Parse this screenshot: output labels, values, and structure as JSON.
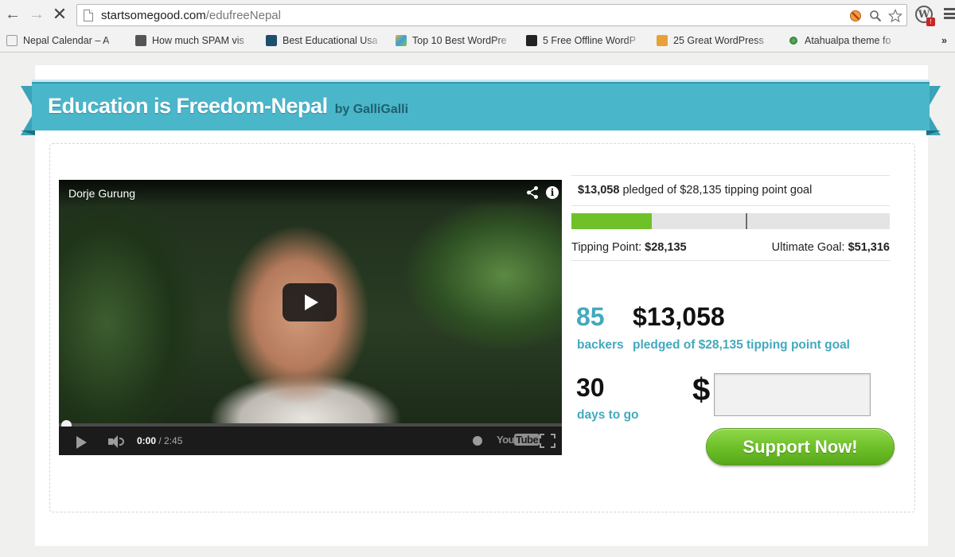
{
  "browser": {
    "url_host": "startsomegood.com",
    "url_path": "/edufreeNepal",
    "bookmarks": [
      {
        "label": "Nepal Calendar – A",
        "favicon_color": "#ffffff"
      },
      {
        "label": "How much SPAM vis",
        "favicon_color": "#555555"
      },
      {
        "label": "Best Educational Usa",
        "favicon_color": "#1d4e6e"
      },
      {
        "label": "Top 10 Best WordPre",
        "favicon_color": "#e0b53a"
      },
      {
        "label": "5 Free Offline WordP",
        "favicon_color": "#222222"
      },
      {
        "label": "25 Great WordPress",
        "favicon_color": "#e8a13a"
      },
      {
        "label": "Atahualpa theme fo",
        "favicon_color": "#4caf50"
      }
    ]
  },
  "campaign": {
    "title": "Education is Freedom-Nepal",
    "byline": "by GalliGalli"
  },
  "video": {
    "title": "Dorje Gurung",
    "current_time": "0:00",
    "separator": " / ",
    "duration": "2:45",
    "youtube_you": "You",
    "youtube_tube": "Tube"
  },
  "stats": {
    "pledged_amount": "$13,058",
    "pledged_suffix": " pledged of $28,135 tipping point goal",
    "progress_fraction": 0.253,
    "tipping_marker_fraction": 0.547,
    "tipping_point_label": "Tipping Point:",
    "tipping_point_value": "$28,135",
    "ultimate_goal_label": "Ultimate Goal:",
    "ultimate_goal_value": "$51,316",
    "backers_count": "85",
    "backers_label": "backers",
    "pledged_big": "$13,058",
    "pledged_big_label": "pledged of $28,135 tipping point goal",
    "days_count": "30",
    "days_label": "days to go"
  },
  "pledge_form": {
    "currency_symbol": "$",
    "amount_value": "",
    "button_label": "Support Now!"
  },
  "colors": {
    "ribbon": "#4ab6ca",
    "accent_teal": "#42a9bd",
    "progress_green": "#6fc12a",
    "button_green": "#6cbf27"
  }
}
